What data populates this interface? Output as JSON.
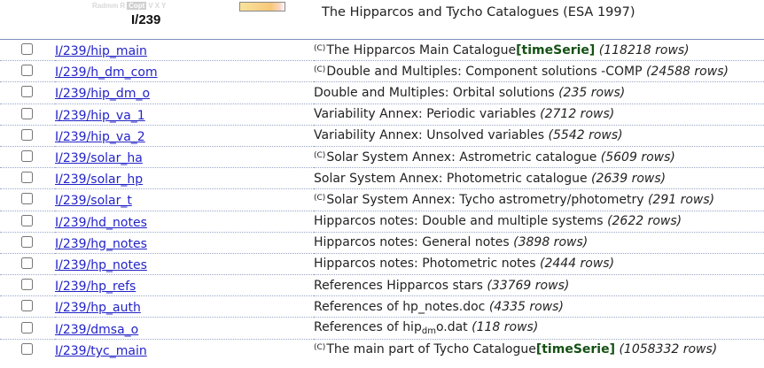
{
  "catalogue": {
    "id": "I/239",
    "title": "The Hipparcos and Tycho Catalogues (ESA 1997)",
    "toolbar_icons": [
      "Radmm",
      "R",
      "Copt",
      "V",
      "X",
      "Y"
    ]
  },
  "tables": [
    {
      "name": "I/239/hip_main",
      "c": true,
      "desc": "The Hipparcos Main Catalogue",
      "ts": "[timeSerie]",
      "rows": "(118218 rows)"
    },
    {
      "name": "I/239/h_dm_com",
      "c": true,
      "desc": "Double and Multiples: Component solutions -COMP",
      "rows": "(24588 rows)"
    },
    {
      "name": "I/239/hip_dm_o",
      "c": false,
      "desc": "Double and Multiples: Orbital solutions",
      "rows": "(235 rows)"
    },
    {
      "name": "I/239/hip_va_1",
      "c": false,
      "desc": "Variability Annex: Periodic variables",
      "rows": "(2712 rows)"
    },
    {
      "name": "I/239/hip_va_2",
      "c": false,
      "desc": "Variability Annex: Unsolved variables",
      "rows": "(5542 rows)"
    },
    {
      "name": "I/239/solar_ha",
      "c": true,
      "desc": "Solar System Annex: Astrometric catalogue",
      "rows": "(5609 rows)"
    },
    {
      "name": "I/239/solar_hp",
      "c": false,
      "desc": "Solar System Annex: Photometric catalogue",
      "rows": "(2639 rows)"
    },
    {
      "name": "I/239/solar_t",
      "c": true,
      "desc": "Solar System Annex: Tycho astrometry/photometry",
      "rows": "(291 rows)"
    },
    {
      "name": "I/239/hd_notes",
      "c": false,
      "desc": "Hipparcos notes: Double and multiple systems",
      "rows": "(2622 rows)"
    },
    {
      "name": "I/239/hg_notes",
      "c": false,
      "desc": "Hipparcos notes: General notes",
      "rows": "(3898 rows)"
    },
    {
      "name": "I/239/hp_notes",
      "c": false,
      "desc": "Hipparcos notes: Photometric notes",
      "rows": "(2444 rows)"
    },
    {
      "name": "I/239/hp_refs",
      "c": false,
      "desc": "References Hipparcos stars",
      "rows": "(33769 rows)"
    },
    {
      "name": "I/239/hp_auth",
      "c": false,
      "desc": "References of hp_notes.doc",
      "rows": "(4335 rows)"
    },
    {
      "name": "I/239/dmsa_o",
      "c": false,
      "desc_pre": "References of hip",
      "desc_sub": "dm",
      "desc_post": "o.dat",
      "rows": "(118 rows)"
    },
    {
      "name": "I/239/tyc_main",
      "c": true,
      "desc": "The main part of Tycho Catalogue",
      "ts": "[timeSerie]",
      "rows": "(1058332 rows)"
    }
  ],
  "copyright_mark": "(C)"
}
